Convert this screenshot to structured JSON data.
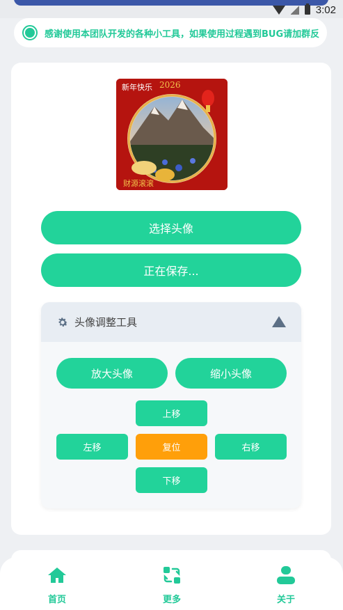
{
  "status_bar": {
    "time": "3:02"
  },
  "notice": {
    "text": "感谢使用本团队开发的各种小工具，如果使用过程遇到BUG请加群反"
  },
  "main": {
    "select_label": "选择头像",
    "save_label": "正在保存..."
  },
  "tool": {
    "title": "头像调整工具",
    "zoom_in": "放大头像",
    "zoom_out": "缩小头像",
    "move_up": "上移",
    "move_left": "左移",
    "reset": "复位",
    "move_right": "右移",
    "move_down": "下移"
  },
  "nav": {
    "items": [
      {
        "label": "首页",
        "icon": "home-icon"
      },
      {
        "label": "更多",
        "icon": "swap-icon"
      },
      {
        "label": "关于",
        "icon": "user-icon"
      }
    ]
  },
  "colors": {
    "accent": "#22d39a",
    "reset": "#ff9f0a",
    "frame_red": "#b5140f"
  }
}
